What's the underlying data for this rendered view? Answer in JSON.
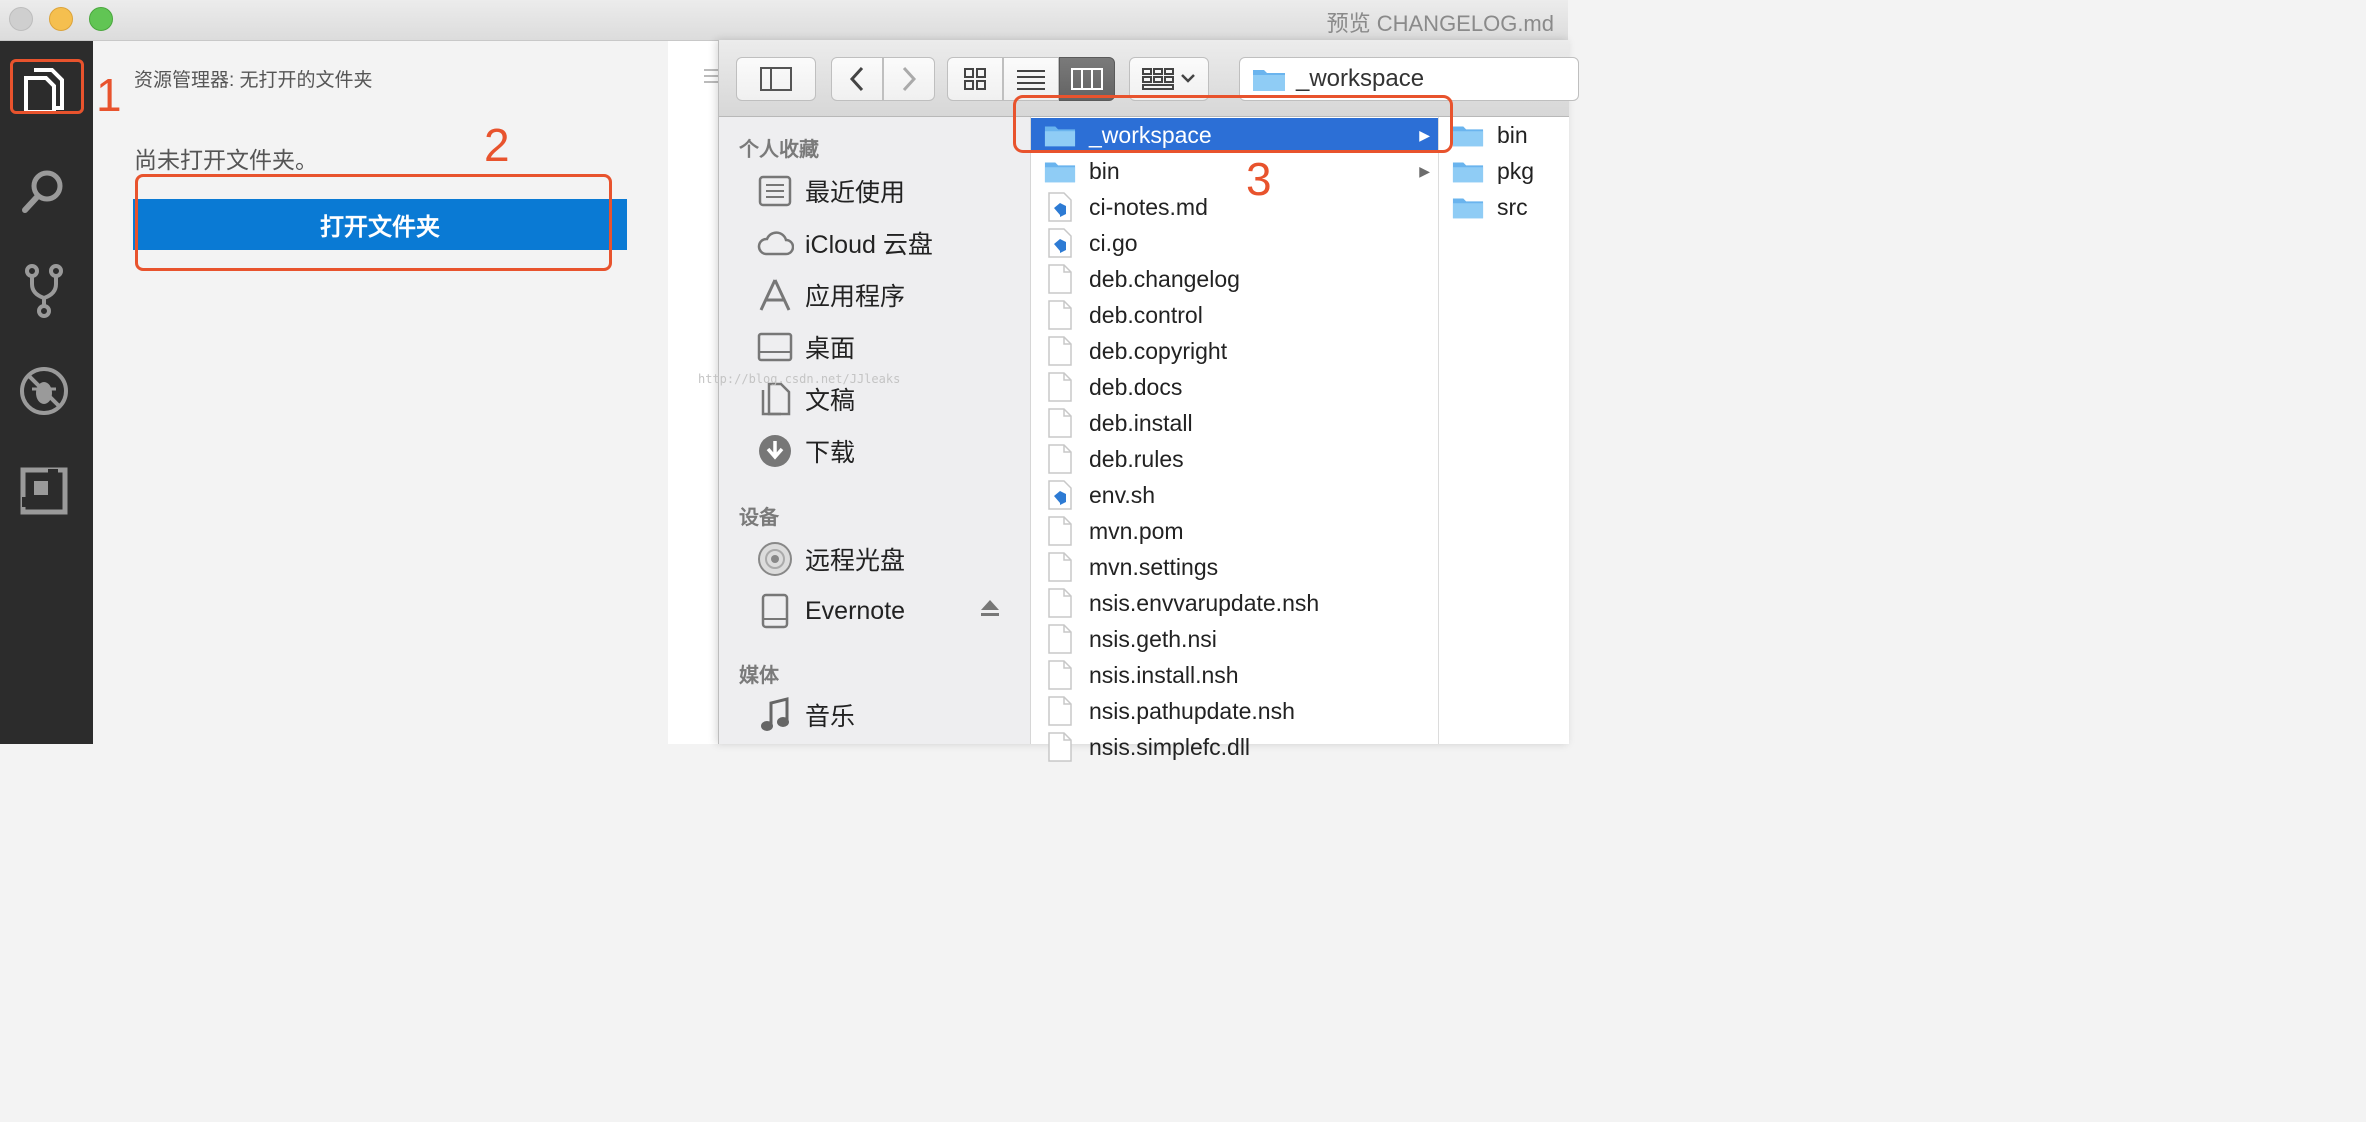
{
  "window": {
    "title": "预览 CHANGELOG.md"
  },
  "vscode": {
    "activity_icons": [
      "explorer-icon",
      "search-icon",
      "git-icon",
      "debug-icon",
      "extensions-icon"
    ],
    "explorer_title": "资源管理器: 无打开的文件夹",
    "empty_message": "尚未打开文件夹。",
    "open_folder_button": "打开文件夹",
    "accent_color": "#0a7ad4"
  },
  "finder": {
    "path_title": "_workspace",
    "sidebar": {
      "favorites_header": "个人收藏",
      "favorites": [
        "最近使用",
        "iCloud 云盘",
        "应用程序",
        "桌面",
        "文稿",
        "下载"
      ],
      "devices_header": "设备",
      "devices": [
        "远程光盘",
        "Evernote"
      ],
      "media_header": "媒体",
      "media": [
        "音乐"
      ]
    },
    "column1": [
      {
        "name": "_workspace",
        "kind": "folder",
        "selected": true,
        "arrow": "▶"
      },
      {
        "name": "bin",
        "kind": "folder",
        "arrow": "▶"
      },
      {
        "name": "ci-notes.md",
        "kind": "vscode"
      },
      {
        "name": "ci.go",
        "kind": "vscode"
      },
      {
        "name": "deb.changelog",
        "kind": "file"
      },
      {
        "name": "deb.control",
        "kind": "file"
      },
      {
        "name": "deb.copyright",
        "kind": "file"
      },
      {
        "name": "deb.docs",
        "kind": "file"
      },
      {
        "name": "deb.install",
        "kind": "file"
      },
      {
        "name": "deb.rules",
        "kind": "file"
      },
      {
        "name": "env.sh",
        "kind": "vscode"
      },
      {
        "name": "mvn.pom",
        "kind": "file"
      },
      {
        "name": "mvn.settings",
        "kind": "file"
      },
      {
        "name": "nsis.envvarupdate.nsh",
        "kind": "file"
      },
      {
        "name": "nsis.geth.nsi",
        "kind": "file"
      },
      {
        "name": "nsis.install.nsh",
        "kind": "file"
      },
      {
        "name": "nsis.pathupdate.nsh",
        "kind": "file"
      },
      {
        "name": "nsis.simplefc.dll",
        "kind": "file"
      }
    ],
    "column2": [
      {
        "name": "bin",
        "kind": "folder"
      },
      {
        "name": "pkg",
        "kind": "folder"
      },
      {
        "name": "src",
        "kind": "folder"
      }
    ],
    "selection_color": "#2c6fd6"
  },
  "annotations": {
    "labels": [
      "1",
      "2",
      "3"
    ],
    "color": "#e8532d"
  },
  "watermark": "http://blog.csdn.net/JJleaks"
}
